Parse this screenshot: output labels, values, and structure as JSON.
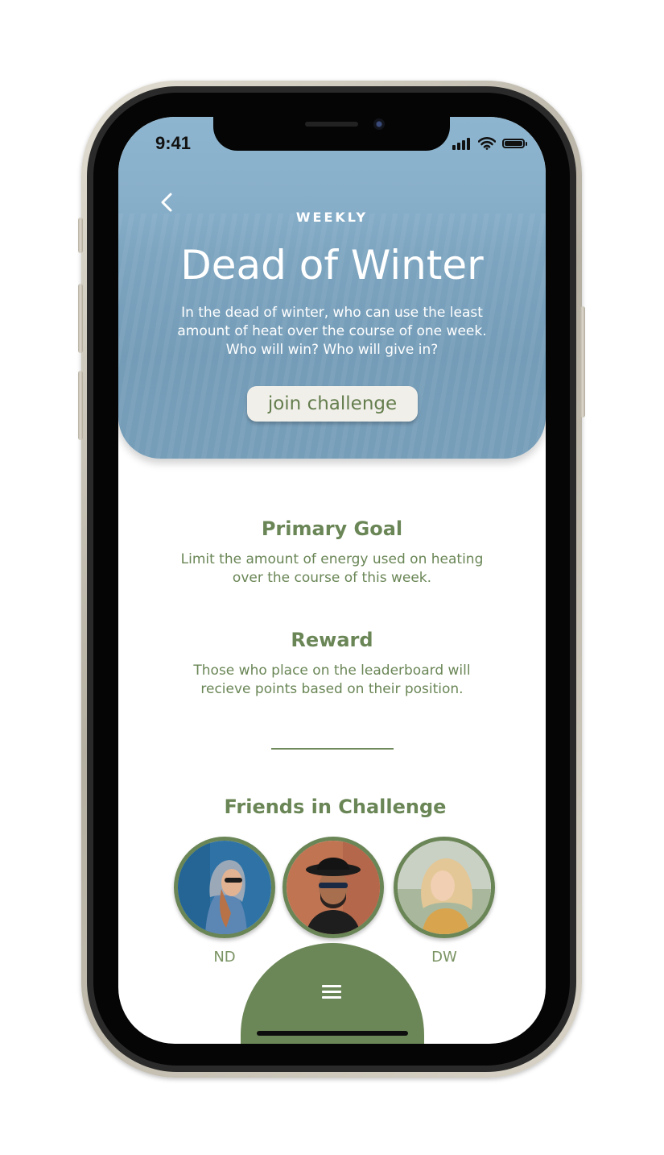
{
  "status_bar": {
    "time": "9:41"
  },
  "header": {
    "back_icon": "chevron-left-icon",
    "kicker": "WEEKLY",
    "title": "Dead of Winter",
    "description_lines": [
      "In the dead of winter, who can use the least",
      "amount of heat over the course of one week.",
      "Who will win? Who will give in?"
    ],
    "join_label": "join challenge"
  },
  "primary_goal": {
    "title": "Primary Goal",
    "text_lines": [
      "Limit the amount of energy used on heating",
      "over the course of this week."
    ]
  },
  "reward": {
    "title": "Reward",
    "text_lines": [
      "Those who place on the leaderboard will",
      "recieve points based on their position."
    ]
  },
  "friends": {
    "title": "Friends in Challenge",
    "items": [
      {
        "initials": "ND"
      },
      {
        "initials": ""
      },
      {
        "initials": "DW"
      }
    ]
  },
  "nav": {
    "menu_icon": "hamburger-menu-icon"
  },
  "colors": {
    "accent_green": "#6a8656",
    "hero_blue": "#85adc8",
    "button_bg": "#f1efe9"
  }
}
